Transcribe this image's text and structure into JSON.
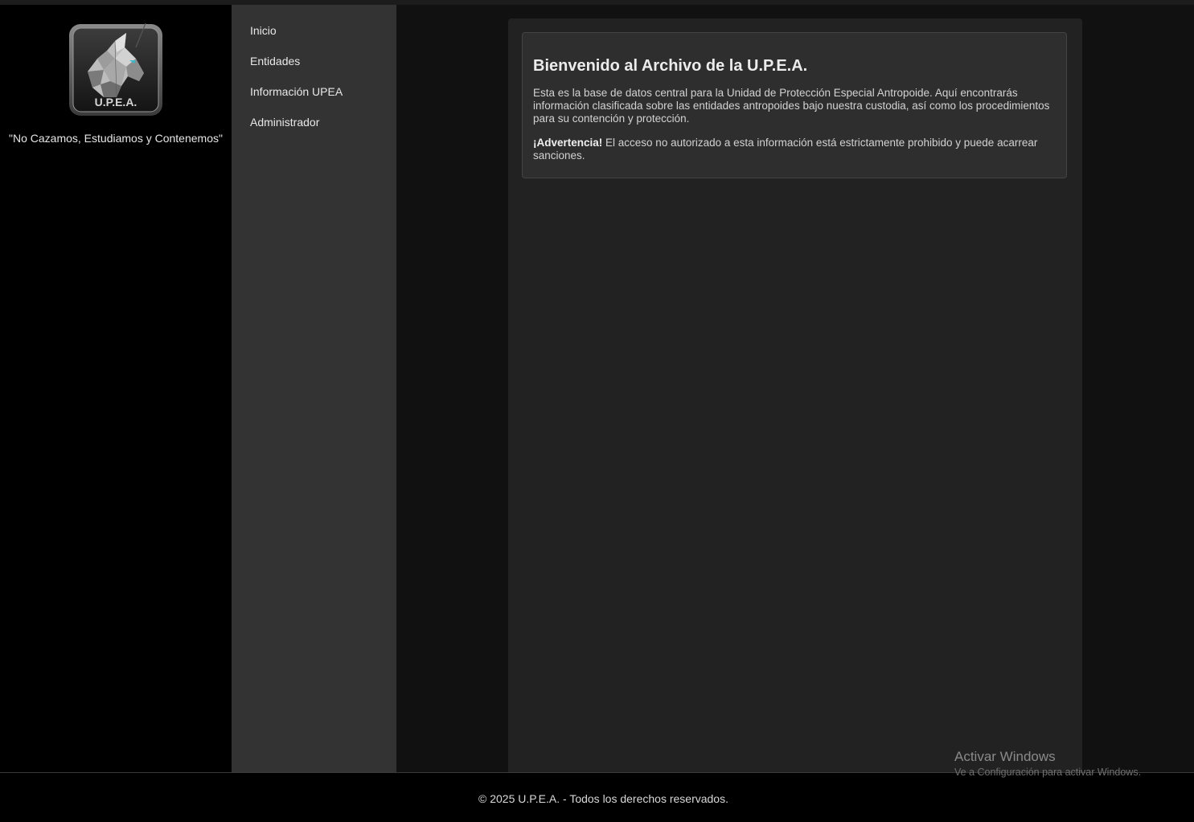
{
  "brand": {
    "logo_text": "U.P.E.A.",
    "slogan": "\"No Cazamos, Estudiamos y Contenemos\""
  },
  "nav": {
    "items": [
      {
        "label": "Inicio"
      },
      {
        "label": "Entidades"
      },
      {
        "label": "Información UPEA"
      },
      {
        "label": "Administrador"
      }
    ]
  },
  "welcome": {
    "title": "Bienvenido al Archivo de la U.P.E.A.",
    "intro": "Esta es la base de datos central para la Unidad de Protección Especial Antropoide. Aquí encontrarás información clasificada sobre las entidades antropoides bajo nuestra custodia, así como los procedimientos para su contención y protección.",
    "warning_label": "¡Advertencia!",
    "warning_text": " El acceso no autorizado a esta información está estrictamente prohibido y puede acarrear sanciones."
  },
  "footer": {
    "text": "© 2025 U.P.E.A. - Todos los derechos reservados."
  },
  "watermark": {
    "title": "Activar Windows",
    "subtitle": "Ve a Configuración para activar Windows."
  },
  "colors": {
    "page_bg": "#111111",
    "left_panel_bg": "#000000",
    "nav_bg": "#333333",
    "content_bg": "#222222",
    "card_bg": "#2e2e2e",
    "eye_accent": "#3fb6c8"
  }
}
